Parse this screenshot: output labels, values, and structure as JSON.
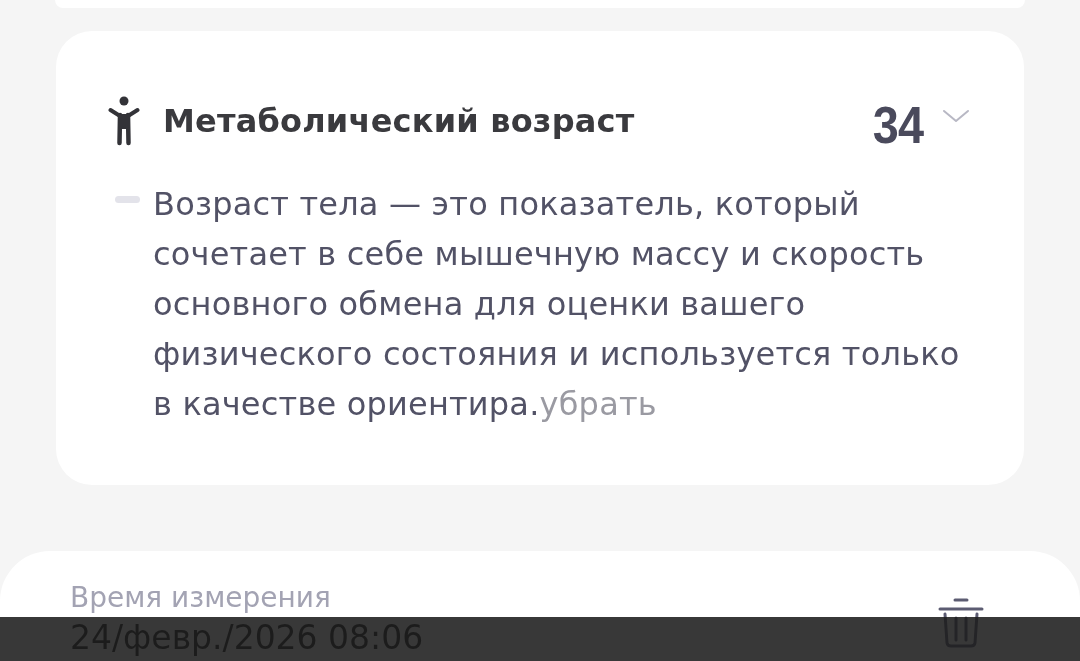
{
  "metric": {
    "title": "Метаболический возраст",
    "value": "34",
    "expanded": true,
    "description": "Возраст тела — это показатель, который сочетает в себе мышечную массу и скорость основного обмена для оценки вашего физического состояния и используется только в качестве ориентира.",
    "dismiss_link": "убрать"
  },
  "measurement": {
    "label": "Время измерения",
    "value": "24/февр./2026 08:06"
  }
}
